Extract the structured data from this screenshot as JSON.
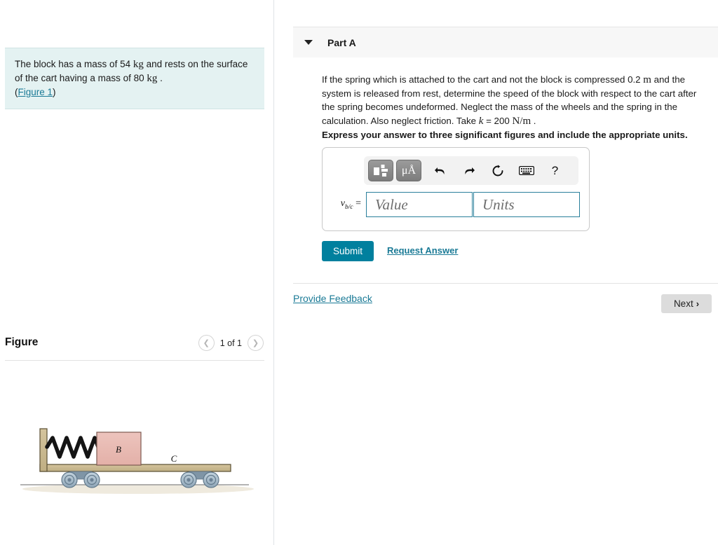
{
  "left_panel": {
    "problem": {
      "line1_a": "The block has a mass of 54 ",
      "line1_unit": "kg",
      "line1_b": " and rests on the surface of the cart having a mass of 80 ",
      "line2_unit": "kg",
      "line2_b": " .",
      "figure_link_open": "(",
      "figure_link": "Figure 1",
      "figure_link_close": ")"
    },
    "figure_section": {
      "title": "Figure",
      "counter": "1 of 1",
      "prev_icon": "chevron-left-icon",
      "next_icon": "chevron-right-icon"
    },
    "diagram": {
      "block_label": "B",
      "cart_label": "C",
      "block_color": "#e8bcb5",
      "cart_color": "#c9b78e",
      "wheel_color": "#a9bccb",
      "spring_color": "#1a1a1a"
    }
  },
  "right_panel": {
    "part": {
      "label": "Part A",
      "caret_icon": "caret-down-icon"
    },
    "question_text": "If the spring which is attached to the cart and not the block is compressed 0.2 m and the system is released from rest, determine the speed of the block with respect to the cart after the spring becomes undeformed. Neglect the mass of the wheels and the spring in the calculation. Also neglect friction. Take k = 200 N/m .",
    "question_parts": {
      "seg1": "If the spring which is attached to the cart and not the block is compressed 0.2 ",
      "unit1": "m",
      "seg2": " and the system is released from rest, determine the speed of the block with respect to the cart after the spring becomes undeformed. Neglect the mass of the wheels and the spring in the calculation. Also neglect friction. Take ",
      "symbol_k": "k",
      "seg3": " = 200 ",
      "unit2": "N/m",
      "seg4": " ."
    },
    "instruction": "Express your answer to three significant figures and include the appropriate units.",
    "toolbar": {
      "template_button": "template-icon",
      "units_button": "μÅ",
      "undo_icon": "undo-icon",
      "redo_icon": "redo-icon",
      "reset_icon": "reset-icon",
      "keyboard_icon": "keyboard-icon",
      "help_icon": "?"
    },
    "answer": {
      "variable": "v",
      "subscript": "b/c",
      "equals": "=",
      "value_placeholder": "Value",
      "units_placeholder": "Units",
      "value": "",
      "units": ""
    },
    "actions": {
      "submit_label": "Submit",
      "request_answer_label": "Request Answer"
    },
    "footer": {
      "feedback_label": "Provide Feedback",
      "next_label": "Next",
      "next_chevron": "›"
    }
  },
  "colors": {
    "accent_teal": "#00809e",
    "link_teal": "#1a7a96",
    "problem_bg": "#e4f2f2",
    "panel_header_bg": "#f7f7f7",
    "input_border": "#2a7f9b"
  }
}
